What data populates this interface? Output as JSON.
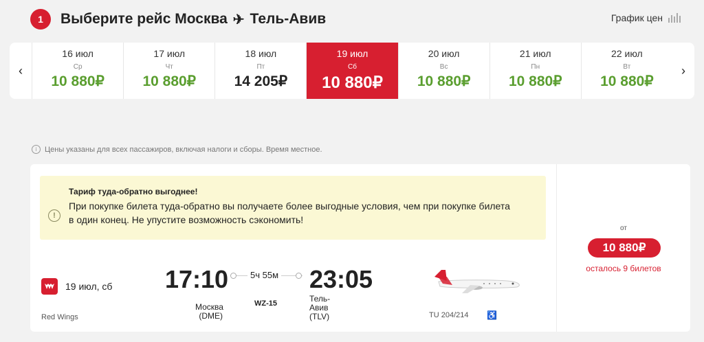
{
  "header": {
    "step_number": "1",
    "title_prefix": "Выберите рейс",
    "origin": "Москва",
    "plane_glyph": "✈",
    "destination": "Тель-Авив",
    "price_chart_label": "График цен",
    "price_chart_icon": "bar-chart-icon"
  },
  "date_strip": {
    "prev_arrow": "‹",
    "next_arrow": "›",
    "days": [
      {
        "date": "16 июл",
        "weekday": "Ср",
        "price": "10 880₽"
      },
      {
        "date": "17 июл",
        "weekday": "Чт",
        "price": "10 880₽"
      },
      {
        "date": "18 июл",
        "weekday": "Пт",
        "price": "14 205₽"
      },
      {
        "date": "19 июл",
        "weekday": "Сб",
        "price": "10 880₽"
      },
      {
        "date": "20 июл",
        "weekday": "Вс",
        "price": "10 880₽"
      },
      {
        "date": "21 июл",
        "weekday": "Пн",
        "price": "10 880₽"
      },
      {
        "date": "22 июл",
        "weekday": "Вт",
        "price": "10 880₽"
      }
    ],
    "selected_index": 3
  },
  "info_note": "Цены указаны для всех пассажиров, включая налоги и сборы. Время местное.",
  "promo": {
    "title": "Тариф туда-обратно выгоднее!",
    "text": "При покупке билета туда-обратно вы получаете более выгодные условия, чем при покупке билета в один конец. Не упустите возможность сэкономить!"
  },
  "flight": {
    "date": "19 июл, сб",
    "airline": "Red Wings",
    "departure_time": "17:10",
    "arrival_time": "23:05",
    "duration": "5ч 55м",
    "flight_number": "WZ-15",
    "departure_city": "Москва (DME)",
    "arrival_city": "Тель-Авив (TLV)",
    "aircraft": "TU 204/214"
  },
  "price_box": {
    "from_label": "от",
    "price": "10 880₽",
    "seats_left": "осталось 9 билетов"
  },
  "colors": {
    "brand_red": "#d71f30",
    "price_green": "#5a9e2f",
    "promo_bg": "#fbf8d4"
  }
}
